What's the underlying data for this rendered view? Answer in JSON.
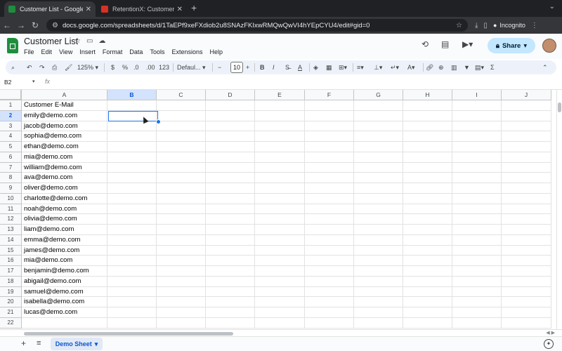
{
  "browser": {
    "tabs": [
      {
        "title": "Customer List - Google Shee",
        "favicon_color": "#1e8e3e",
        "active": true
      },
      {
        "title": "RetentionX: Customer Retent",
        "favicon_color": "#d93025",
        "active": false
      }
    ],
    "new_tab_glyph": "+",
    "url": "docs.google.com/spreadsheets/d/1TaEPf9xeFXdiob2u8SNAzFKIxwRMQwQwVI4hYEpCYU4/edit#gid=0",
    "incognito_label": "Incognito"
  },
  "sheets": {
    "doc_title": "Customer List",
    "menu": [
      "File",
      "Edit",
      "View",
      "Insert",
      "Format",
      "Data",
      "Tools",
      "Extensions",
      "Help"
    ],
    "share_label": "Share",
    "toolbar": {
      "zoom": "125%",
      "currency": "$",
      "percent": "%",
      "decrease_decimal": ".0",
      "increase_decimal": ".00",
      "number_format": "123",
      "font": "Defaul...",
      "font_size": "10",
      "bold": "B",
      "italic": "I",
      "text_color": "A"
    },
    "namebox": "B2",
    "fx": "fx",
    "columns": [
      "A",
      "B",
      "C",
      "D",
      "E",
      "F",
      "G",
      "H",
      "I",
      "J"
    ],
    "selected_column": "B",
    "selected_row": 2,
    "rows": [
      "Customer E-Mail",
      "emily@demo.com",
      "jacob@demo.com",
      "sophia@demo.com",
      "ethan@demo.com",
      "mia@demo.com",
      "william@demo.com",
      "ava@demo.com",
      "oliver@demo.com",
      "charlotte@demo.com",
      "noah@demo.com",
      "olivia@demo.com",
      "liam@demo.com",
      "emma@demo.com",
      "james@demo.com",
      "mia@demo.com",
      "benjamin@demo.com",
      "abigail@demo.com",
      "samuel@demo.com",
      "isabella@demo.com",
      "lucas@demo.com",
      ""
    ],
    "sheet_tab": "Demo Sheet"
  }
}
